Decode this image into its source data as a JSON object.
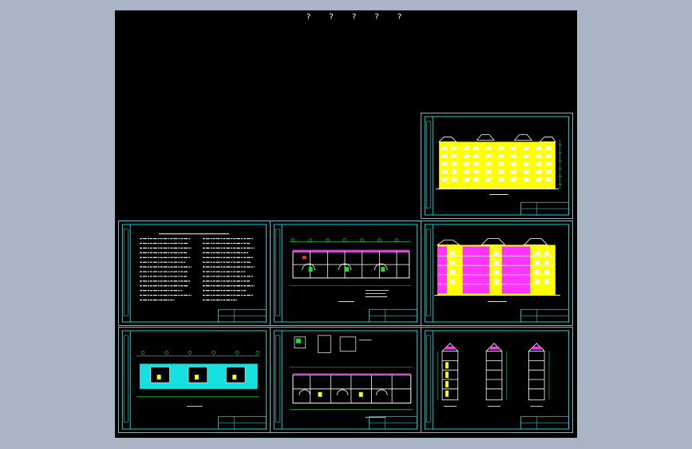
{
  "drawing": {
    "title": "? ? ? ? ?"
  },
  "colors": {
    "background": "#a9b4c4",
    "canvas": "#000000",
    "frame": "#00d8d8",
    "frame_outer": "#6fb9c9",
    "line_white": "#ffffff",
    "elevation_yellow": "#ffff00",
    "elevation_magenta": "#ff33ff",
    "plan_fill": "#16e0e0",
    "green": "#19e619",
    "red": "#ff3030"
  },
  "sheets": [
    {
      "id": "elevation-1",
      "icon": "building-elevation-yellow"
    },
    {
      "id": "general-notes",
      "icon": "text-notes"
    },
    {
      "id": "floor-plan-1",
      "icon": "floor-plan"
    },
    {
      "id": "elevation-2",
      "icon": "building-elevation-magenta"
    },
    {
      "id": "floor-plan-cyan",
      "icon": "floor-plan-filled"
    },
    {
      "id": "floor-plan-details",
      "icon": "floor-plan-with-details"
    },
    {
      "id": "sections",
      "icon": "building-sections"
    }
  ]
}
